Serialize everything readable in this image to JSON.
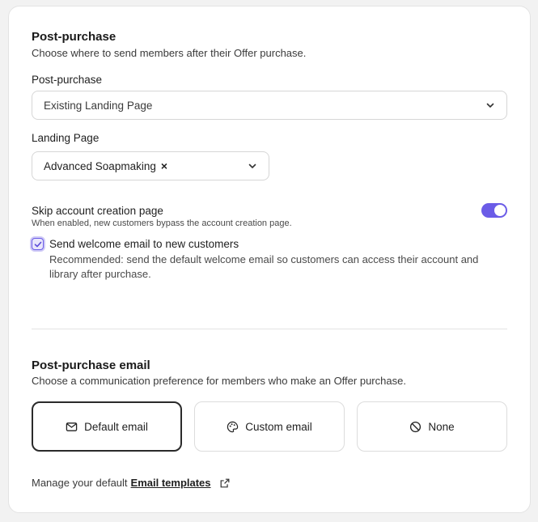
{
  "section": {
    "title": "Post-purchase",
    "subtitle": "Choose where to send members after their Offer purchase."
  },
  "post_purchase_field": {
    "label": "Post-purchase",
    "value": "Existing Landing Page"
  },
  "landing_page_field": {
    "label": "Landing Page",
    "tag": "Advanced Soapmaking",
    "remove": "×"
  },
  "skip_account": {
    "label": "Skip account creation page",
    "help": "When enabled, new customers bypass the account creation page.",
    "enabled": true
  },
  "welcome_email": {
    "label": "Send welcome email to new customers",
    "description_line1": "Recommended: send the default welcome email so customers can access their account and",
    "description_line2": "library after purchase.",
    "checked": true
  },
  "email_section": {
    "title": "Post-purchase email",
    "subtitle": "Choose a communication preference for members who make an Offer purchase.",
    "options": [
      {
        "label": "Default email",
        "icon": "mail-icon",
        "selected": true
      },
      {
        "label": "Custom email",
        "icon": "palette-icon",
        "selected": false
      },
      {
        "label": "None",
        "icon": "ban-icon",
        "selected": false
      }
    ]
  },
  "footer": {
    "prefix": "Manage your default",
    "link": "Email templates",
    "icon": "external-link-icon"
  },
  "colors": {
    "accent": "#6b5ce7",
    "selected_border": "#2a2a2a"
  }
}
